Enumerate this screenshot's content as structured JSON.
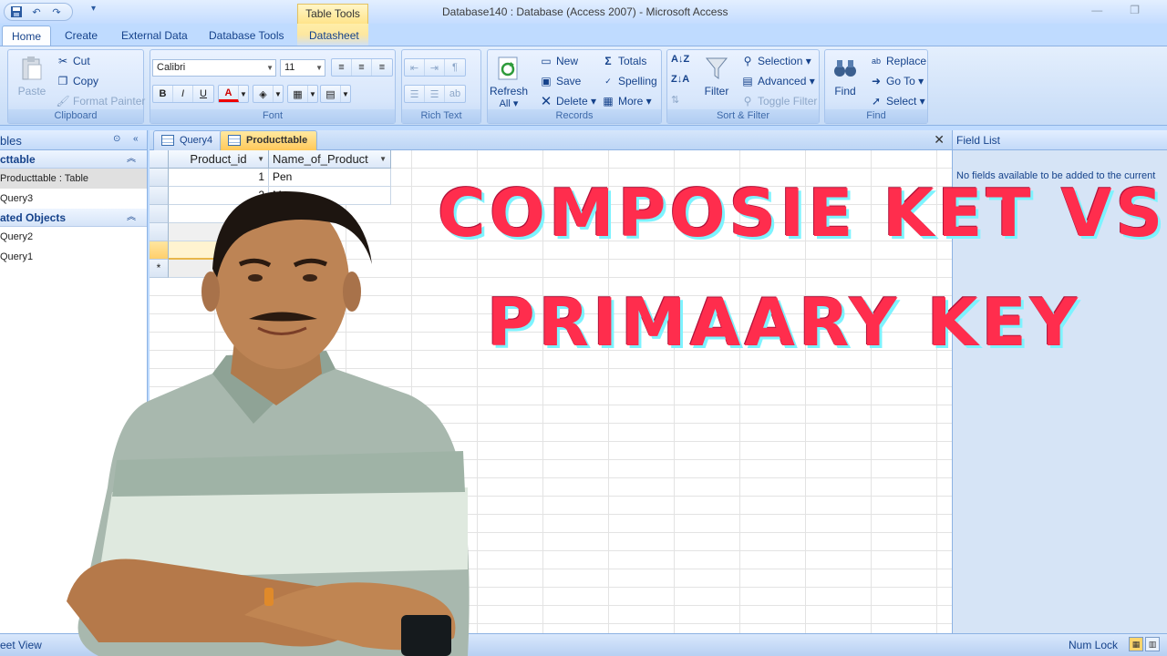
{
  "window": {
    "title": "Database140 : Database (Access 2007)  -  Microsoft Access",
    "context_tab_title": "Table Tools",
    "minimize": "—",
    "restore": "❐"
  },
  "ribbon_tabs": [
    "Home",
    "Create",
    "External Data",
    "Database Tools",
    "Datasheet"
  ],
  "ribbon": {
    "clipboard": {
      "label": "Clipboard",
      "paste": "Paste",
      "cut": "Cut",
      "copy": "Copy",
      "format_painter": "Format Painter"
    },
    "font": {
      "label": "Font",
      "font_name": "Calibri",
      "font_size": "11"
    },
    "rich_text": {
      "label": "Rich Text"
    },
    "records": {
      "label": "Records",
      "refresh": "Refresh",
      "refresh_sub": "All ▾",
      "new": "New",
      "save": "Save",
      "delete": "Delete ▾",
      "totals": "Totals",
      "spelling": "Spelling",
      "more": "More ▾"
    },
    "sort_filter": {
      "label": "Sort & Filter",
      "filter": "Filter",
      "selection": "Selection ▾",
      "advanced": "Advanced ▾",
      "toggle_filter": "Toggle Filter"
    },
    "find": {
      "label": "Find",
      "find": "Find",
      "replace": "Replace",
      "go_to": "Go To ▾",
      "select": "Select ▾"
    }
  },
  "nav_pane": {
    "header": "bles",
    "groups": [
      {
        "title": "cttable",
        "items": [
          {
            "label": "Producttable : Table",
            "selected": true
          },
          {
            "label": "Query3",
            "selected": false
          }
        ]
      },
      {
        "title": "ated Objects",
        "items": [
          {
            "label": "Query2",
            "selected": false
          },
          {
            "label": "Query1",
            "selected": false
          }
        ]
      }
    ]
  },
  "doc_tabs": [
    {
      "label": "Query4",
      "active": false
    },
    {
      "label": "Producttable",
      "active": true
    }
  ],
  "datasheet": {
    "columns": [
      "Product_id",
      "Name_of_Product"
    ],
    "rows": [
      {
        "id": "1",
        "name": "Pen"
      },
      {
        "id": "2",
        "name": "Mo"
      }
    ],
    "new_row_marker": "*"
  },
  "field_list": {
    "title": "Field List",
    "message": "No fields available to be added to the current"
  },
  "status_bar": {
    "left": "eet View",
    "num_lock": "Num Lock"
  },
  "overlay": {
    "line1": "COMPOSIE KET VS",
    "line2": "PRIMAARY KEY"
  },
  "colors": {
    "headline": "#ff2d4d",
    "headline_shadow": "#7df3ff",
    "ribbon_text": "#15428b"
  }
}
